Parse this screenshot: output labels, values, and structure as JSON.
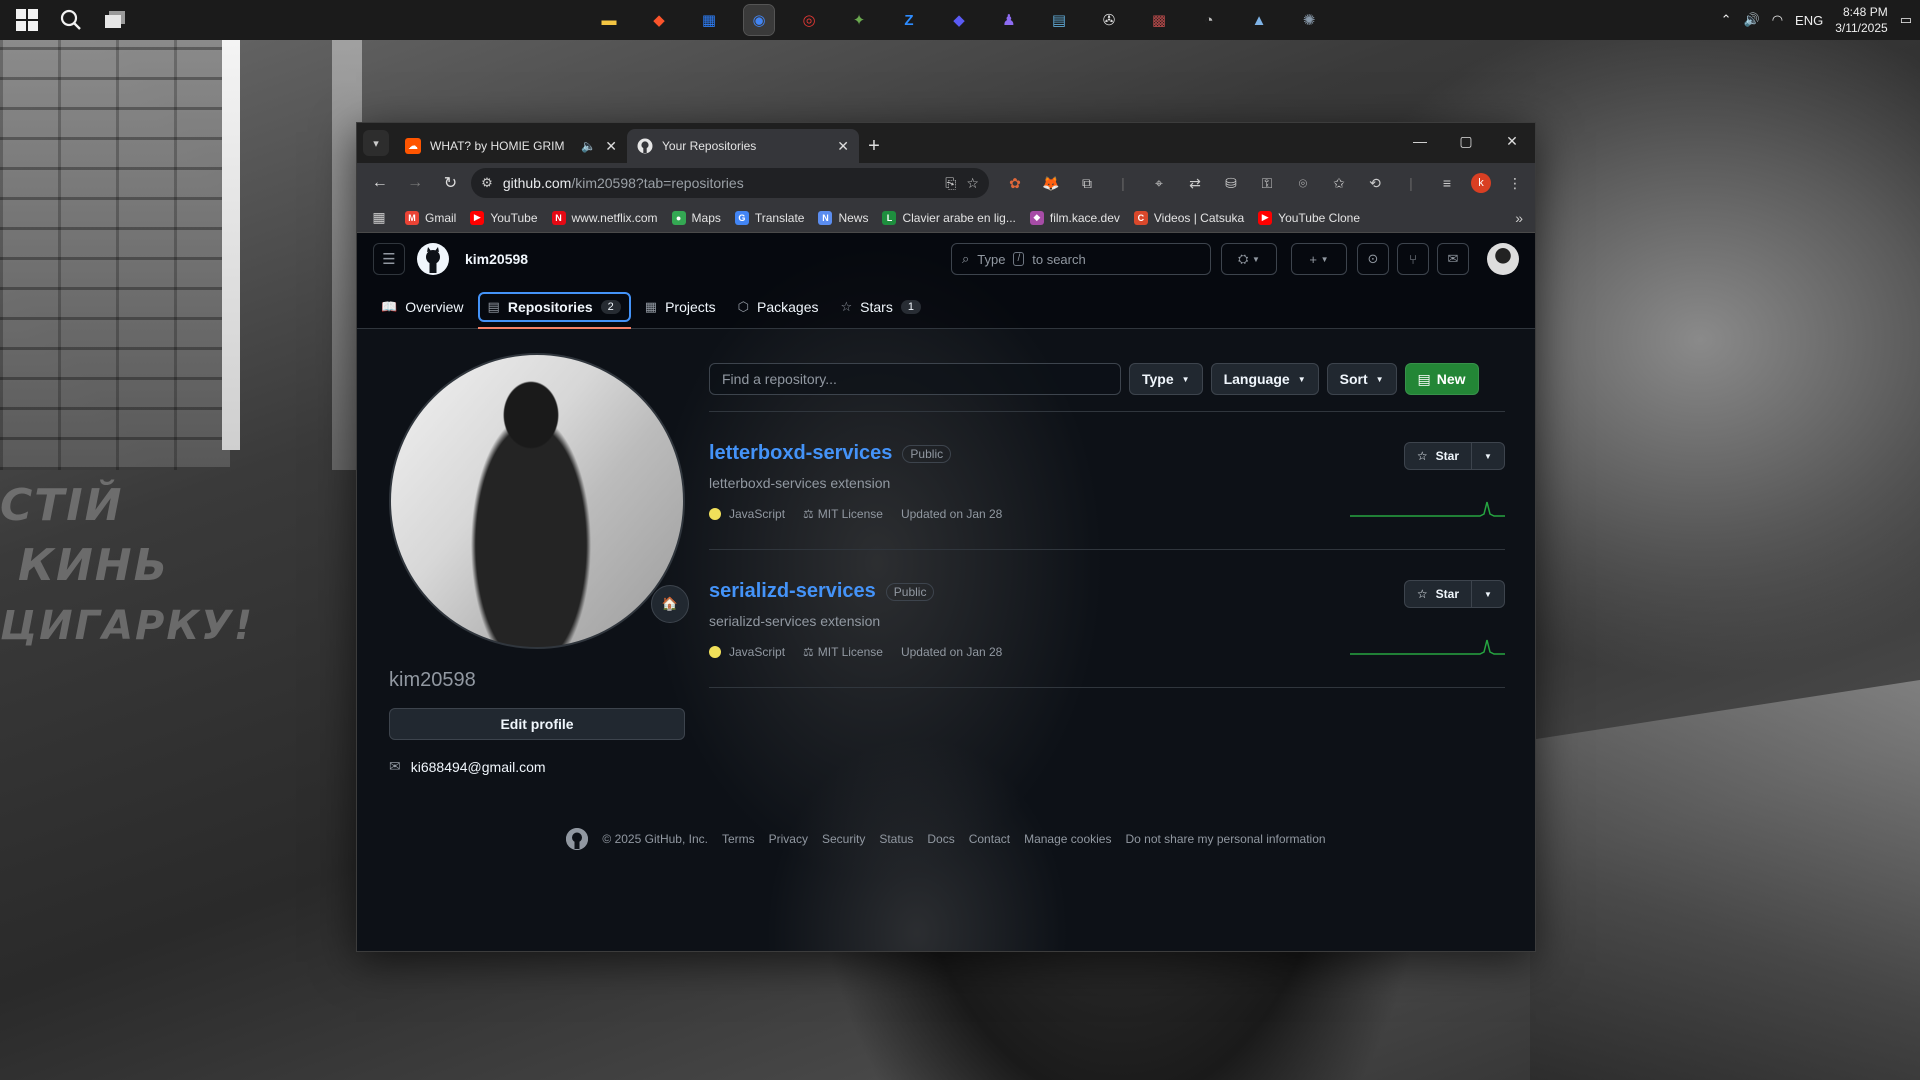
{
  "taskbar": {
    "start_icon": "windows-icon",
    "search_icon": "search-icon",
    "taskview_icon": "task-view-icon",
    "apps": [
      {
        "name": "file-explorer",
        "glyph": "▬",
        "color": "#f4c542"
      },
      {
        "name": "brave",
        "glyph": "◆",
        "color": "#fb542b"
      },
      {
        "name": "microsoft-store",
        "glyph": "▦",
        "color": "#2d7df6"
      },
      {
        "name": "chrome",
        "glyph": "◉",
        "color": "#4285f4"
      },
      {
        "name": "app-red",
        "glyph": "◎",
        "color": "#e53935"
      },
      {
        "name": "app-bird",
        "glyph": "✦",
        "color": "#6aa84f"
      },
      {
        "name": "zoom",
        "glyph": "Z",
        "color": "#2d8cff"
      },
      {
        "name": "app-diamond",
        "glyph": "◆",
        "color": "#5b5bf5"
      },
      {
        "name": "app-purple",
        "glyph": "♟",
        "color": "#8e6cf2"
      },
      {
        "name": "app-screen",
        "glyph": "▤",
        "color": "#5fa8d3"
      },
      {
        "name": "app-circle",
        "glyph": "✇",
        "color": "#dddddd"
      },
      {
        "name": "app-game",
        "glyph": "▩",
        "color": "#b84a4a"
      },
      {
        "name": "app-dial",
        "glyph": "◔",
        "color": "#bbbbbb"
      },
      {
        "name": "app-monitor",
        "glyph": "▲",
        "color": "#7fb3e6"
      },
      {
        "name": "app-atom",
        "glyph": "✺",
        "color": "#8899aa"
      }
    ],
    "language": "ENG",
    "time": "8:48 PM",
    "date": "3/11/2025"
  },
  "browser": {
    "tabs": [
      {
        "title": "WHAT? by HOMIE GRIM",
        "favicon": "soundcloud-icon",
        "color": "#ff5500",
        "audio": true
      },
      {
        "title": "Your Repositories",
        "favicon": "github-icon",
        "color": "#ffffff",
        "active": true
      }
    ],
    "url_host": "github.com",
    "url_path": "/kim20598?tab=repositories",
    "profile_initial": "k",
    "bookmarks": [
      {
        "label": "Gmail",
        "icon": "gmail-icon",
        "color": "#ea4335",
        "glyph": "M"
      },
      {
        "label": "YouTube",
        "icon": "youtube-icon",
        "color": "#ff0000",
        "glyph": "▶"
      },
      {
        "label": "www.netflix.com",
        "icon": "netflix-icon",
        "color": "#e50914",
        "glyph": "N"
      },
      {
        "label": "Maps",
        "icon": "maps-icon",
        "color": "#34a853",
        "glyph": "●"
      },
      {
        "label": "Translate",
        "icon": "translate-icon",
        "color": "#4285f4",
        "glyph": "G"
      },
      {
        "label": "News",
        "icon": "news-icon",
        "color": "#5b8def",
        "glyph": "N"
      },
      {
        "label": "Clavier arabe en lig...",
        "icon": "clavier-icon",
        "color": "#1e8e3e",
        "glyph": "L"
      },
      {
        "label": "film.kace.dev",
        "icon": "film-icon",
        "color": "#a64ca6",
        "glyph": "◆"
      },
      {
        "label": "Videos | Catsuka",
        "icon": "catsuka-icon",
        "color": "#d9482b",
        "glyph": "C"
      },
      {
        "label": "YouTube Clone",
        "icon": "youtube-clone-icon",
        "color": "#ff0000",
        "glyph": "▶"
      }
    ]
  },
  "github": {
    "username": "kim20598",
    "search_placeholder_pre": "Type",
    "search_key": "/",
    "search_placeholder_post": "to search",
    "tabs": [
      {
        "label": "Overview",
        "icon": "book-icon",
        "glyph": "📖"
      },
      {
        "label": "Repositories",
        "icon": "repo-icon",
        "glyph": "▤",
        "count": "2",
        "selected": true
      },
      {
        "label": "Projects",
        "icon": "table-icon",
        "glyph": "▦"
      },
      {
        "label": "Packages",
        "icon": "package-icon",
        "glyph": "⬡"
      },
      {
        "label": "Stars",
        "icon": "star-icon",
        "glyph": "☆",
        "count": "1"
      }
    ],
    "profile": {
      "name": "kim20598",
      "status_emoji": "🏠",
      "edit_label": "Edit profile",
      "email": "ki688494@gmail.com"
    },
    "filters": {
      "find_placeholder": "Find a repository...",
      "type_label": "Type",
      "language_label": "Language",
      "sort_label": "Sort",
      "new_label": "New"
    },
    "repos": [
      {
        "name": "letterboxd-services",
        "visibility": "Public",
        "description": "letterboxd-services extension",
        "language": "JavaScript",
        "language_color": "#f1e05a",
        "license": "MIT License",
        "updated": "Updated on Jan 28",
        "star_label": "Star"
      },
      {
        "name": "serializd-services",
        "visibility": "Public",
        "description": "serializd-services extension",
        "language": "JavaScript",
        "language_color": "#f1e05a",
        "license": "MIT License",
        "updated": "Updated on Jan 28",
        "star_label": "Star"
      }
    ],
    "footer": {
      "copyright": "© 2025 GitHub, Inc.",
      "links": [
        "Terms",
        "Privacy",
        "Security",
        "Status",
        "Docs",
        "Contact",
        "Manage cookies",
        "Do not share my personal information"
      ]
    }
  },
  "wallpaper": {
    "graffiti_lines": [
      "СТІЙ",
      "КИНЬ",
      "ЦИГАРКУ!"
    ]
  }
}
